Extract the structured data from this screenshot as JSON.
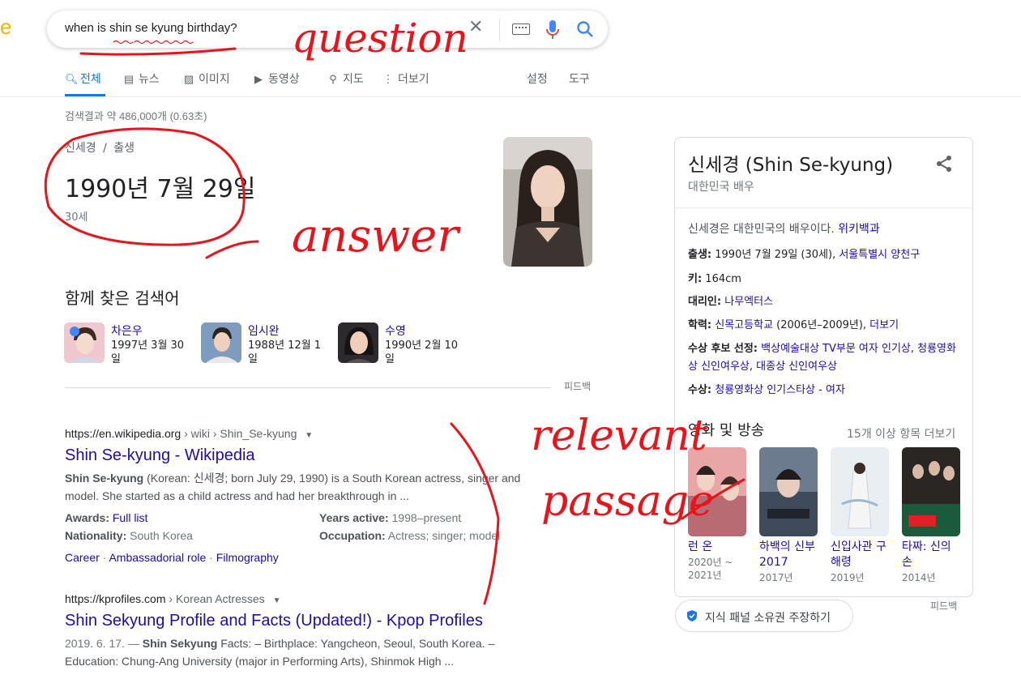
{
  "search": {
    "query": "when is shin se kyung birthday?",
    "clear_icon": "close-icon",
    "keyboard_icon": "keyboard-icon",
    "mic_icon": "mic-icon",
    "search_icon": "search-icon"
  },
  "tabs": {
    "all": "전체",
    "news": "뉴스",
    "images": "이미지",
    "videos": "동영상",
    "maps": "지도",
    "more": "더보기",
    "settings": "설정",
    "tools": "도구"
  },
  "result_stats": "검색결과 약 486,000개 (0.63초)",
  "answer": {
    "breadcrumb_entity": "신세경",
    "breadcrumb_sep": "/",
    "breadcrumb_attr": "출생",
    "value": "1990년 7월 29일",
    "age": "30세"
  },
  "people_also_search": {
    "title": "함께 찾은 검색어",
    "items": [
      {
        "name": "차은우",
        "date": "1997년 3월 30일"
      },
      {
        "name": "임시완",
        "date": "1988년 12월 1일"
      },
      {
        "name": "수영",
        "date": "1990년 2월 10일"
      }
    ],
    "feedback": "피드백"
  },
  "results": [
    {
      "domain": "https://en.wikipedia.org",
      "path": " › wiki › Shin_Se-kyung",
      "title": "Shin Se-kyung - Wikipedia",
      "snippet_bold": "Shin Se-kyung",
      "snippet_line1": " (Korean: 신세경; born July 29, 1990) is a South Korean actress, singer and",
      "snippet_line2": "model. She started as a child actress and had her breakthrough in ...",
      "awards_label": "Awards:",
      "awards_value": "Full list",
      "years_label": "Years active:",
      "years_value": "1998–present",
      "nationality_label": "Nationality:",
      "nationality_value": "South Korea",
      "occupation_label": "Occupation:",
      "occupation_value": "Actress; singer; model",
      "sitelinks": [
        "Career",
        "Ambassadorial role",
        "Filmography"
      ]
    },
    {
      "domain": "https://kprofiles.com",
      "path": " › Korean Actresses",
      "title": "Shin Sekyung Profile and Facts (Updated!) - Kpop Profiles",
      "date": "2019. 6. 17. — ",
      "snippet_bold": "Shin Sekyung",
      "snippet_line1": " Facts: – Birthplace: Yangcheon, Seoul, South Korea. –",
      "snippet_line2": "Education: Chung-Ang University (major in Performing Arts), Shinmok High ..."
    }
  ],
  "knowledge_panel": {
    "title": "신세경 (Shin Se-kyung)",
    "subtitle": "대한민국 배우",
    "desc": "신세경은 대한민국의 배우이다. ",
    "desc_link": "위키백과",
    "born_label": "출생:",
    "born_value": " 1990년 7월 29일 (30세), ",
    "born_link": "서울특별시 양천구",
    "height_label": "키:",
    "height_value": " 164cm",
    "agency_label": "대리인:",
    "agency_link": "나무엑터스",
    "edu_label": "학력:",
    "edu_link": "신목고등학교",
    "edu_value": " (2006년–2009년), ",
    "edu_more": "더보기",
    "nom_label": "수상 후보 선정:",
    "nom_link1": "백상예술대상 TV부문 여자 인기상",
    "nom_link2": "청룡영화상 신인여우상",
    "nom_link3": "대종상 신인여우상",
    "award_label": "수상:",
    "award_link": "청룡영화상 인기스타상 - 여자",
    "movies_title": "영화 및 방송",
    "movies_more": "15개 이상 항목 더보기",
    "movies": [
      {
        "title": "런 온",
        "year": "2020년 ~ 2021년"
      },
      {
        "title": "하백의 신부 2017",
        "year": "2017년"
      },
      {
        "title": "신입사관 구해령",
        "year": "2019년"
      },
      {
        "title": "타짜: 신의 손",
        "year": "2014년"
      }
    ],
    "feedback": "피드백",
    "claim": "지식 패널 소유권 주장하기"
  },
  "annotations": {
    "question": "question",
    "answer": "answer",
    "relevant": "relevant",
    "passage": "passage",
    "color": "#e8141b"
  }
}
